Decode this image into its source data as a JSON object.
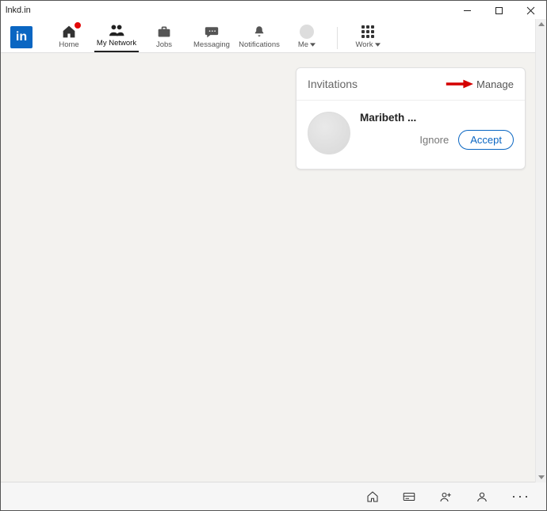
{
  "window": {
    "title": "lnkd.in"
  },
  "logo": {
    "text": "in"
  },
  "nav": {
    "home": {
      "label": "Home"
    },
    "network": {
      "label": "My Network"
    },
    "jobs": {
      "label": "Jobs"
    },
    "messaging": {
      "label": "Messaging"
    },
    "notifications": {
      "label": "Notifications"
    },
    "me": {
      "label": "Me"
    },
    "work": {
      "label": "Work"
    }
  },
  "invitations": {
    "heading": "Invitations",
    "manage_label": "Manage",
    "items": [
      {
        "name": "Maribeth ...",
        "ignore": "Ignore",
        "accept": "Accept"
      }
    ]
  },
  "colors": {
    "brand": "#0a66c2",
    "badge": "#e30909",
    "annotation": "#d40000"
  }
}
